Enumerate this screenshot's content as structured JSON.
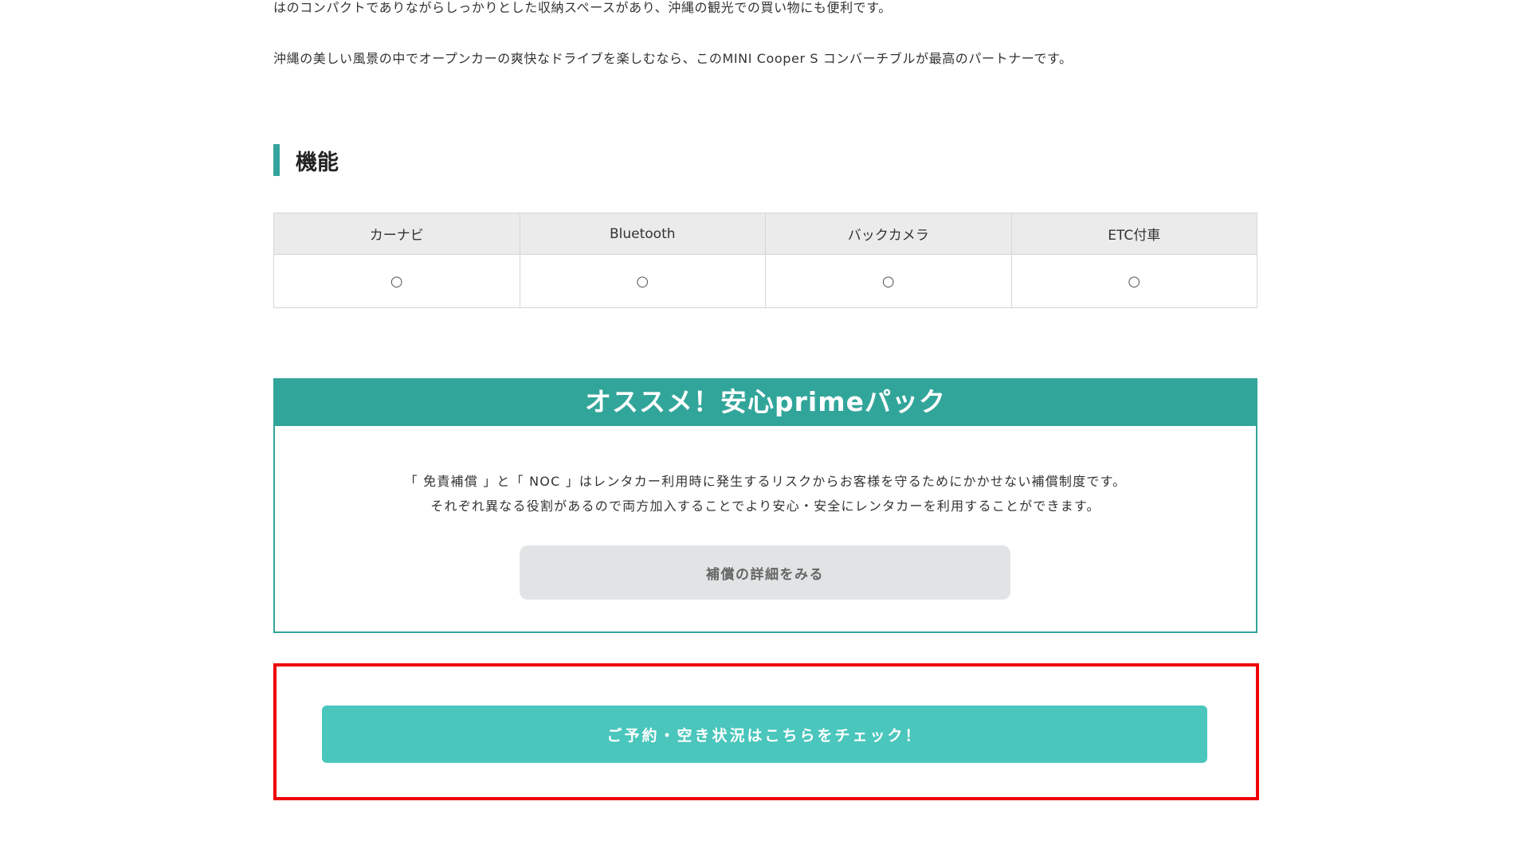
{
  "intro": {
    "paragraph_1": "はのコンパクトでありながらしっかりとした収納スペースがあり、沖縄の観光での買い物にも便利です。",
    "paragraph_2": "沖縄の美しい風景の中でオープンカーの爽快なドライブを楽しむなら、このMINI Cooper S コンバーチブルが最高のパートナーです。"
  },
  "features": {
    "heading": "機能",
    "columns": [
      "カーナビ",
      "Bluetooth",
      "バックカメラ",
      "ETC付車"
    ],
    "values": [
      "○",
      "○",
      "○",
      "○"
    ]
  },
  "prime_pack": {
    "title": "オススメ！安心primeパック",
    "description_line_1": "「 免責補償 」と「 NOC 」はレンタカー利用時に発生するリスクからお客様を守るためにかかせない補償制度です。",
    "description_line_2": "それぞれ異なる役割があるので両方加入することでより安心・安全にレンタカーを利用することができます。",
    "detail_button_label": "補償の詳細をみる"
  },
  "cta": {
    "button_label": "ご予約・空き状況はこちらをチェック！"
  },
  "colors": {
    "accent_teal": "#32a59a",
    "cta_teal": "#4ac6bc",
    "highlight_red": "#ee0000",
    "table_header_bg": "#ebebeb",
    "secondary_button_bg": "#e1e4e5"
  }
}
